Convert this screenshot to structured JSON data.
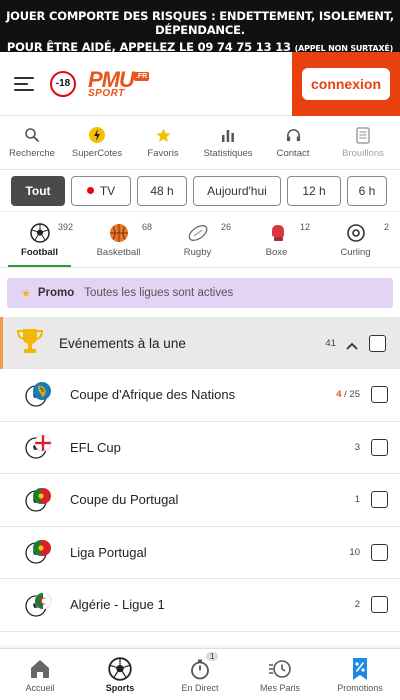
{
  "warning": {
    "line1": "Jouer comporte des risques : endettement, isolement, dépendance.",
    "line2": "Pour être aidé, appelez le 09 74 75 13 13",
    "line2_small": "(appel non surtaxé)"
  },
  "header": {
    "age_badge": "-18",
    "logo_text": "PMU",
    "logo_suffix": ".FR",
    "logo_sub": "SPORT",
    "login_label": "connexion"
  },
  "quick_nav": [
    {
      "label": "Recherche",
      "icon": "search-icon"
    },
    {
      "label": "SuperCotes",
      "icon": "supercotes-icon"
    },
    {
      "label": "Favoris",
      "icon": "star-icon"
    },
    {
      "label": "Statistiques",
      "icon": "stats-icon"
    },
    {
      "label": "Contact",
      "icon": "headset-icon"
    },
    {
      "label": "Brouillons",
      "icon": "drafts-icon"
    }
  ],
  "time_filters": [
    "Tout",
    "TV",
    "48 h",
    "Aujourd'hui",
    "12 h",
    "6 h"
  ],
  "sports": [
    {
      "label": "Football",
      "count": "392"
    },
    {
      "label": "Basketball",
      "count": "68"
    },
    {
      "label": "Rugby",
      "count": "26"
    },
    {
      "label": "Boxe",
      "count": "12"
    },
    {
      "label": "Curling",
      "count": "2"
    }
  ],
  "promo": {
    "title": "Promo",
    "text": "Toutes les ligues sont actives"
  },
  "featured": {
    "title": "Evénements à la une",
    "count": "41"
  },
  "competitions": [
    {
      "name": "Coupe d'Afrique des Nations",
      "count_highlight": "4",
      "count_rest": " / 25",
      "flag": "africa"
    },
    {
      "name": "EFL Cup",
      "count_highlight": "",
      "count_rest": "3",
      "flag": "england"
    },
    {
      "name": "Coupe du Portugal",
      "count_highlight": "",
      "count_rest": "1",
      "flag": "portugal"
    },
    {
      "name": "Liga Portugal",
      "count_highlight": "",
      "count_rest": "10",
      "flag": "portugal"
    },
    {
      "name": "Algérie - Ligue 1",
      "count_highlight": "",
      "count_rest": "2",
      "flag": "algeria"
    }
  ],
  "bottom_nav": [
    {
      "label": "Accueil",
      "icon": "home-icon"
    },
    {
      "label": "Sports",
      "icon": "soccer-ball-icon"
    },
    {
      "label": "En Direct",
      "icon": "stopwatch-icon",
      "badge": "1"
    },
    {
      "label": "Mes Paris",
      "icon": "history-icon"
    },
    {
      "label": "Promotions",
      "icon": "bookmark-percent-icon"
    }
  ],
  "colors": {
    "brand_orange": "#e8541a",
    "login_bg": "#e8400e",
    "promo_bg": "#e3d3f5",
    "active_green": "#2a9a3a",
    "live_red": "#e30613"
  }
}
